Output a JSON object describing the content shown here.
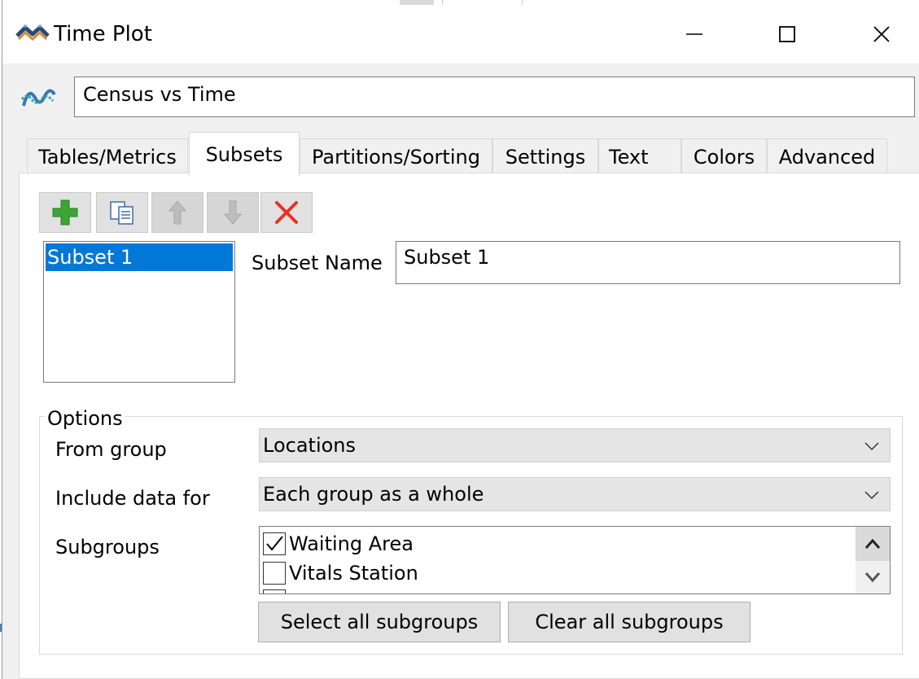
{
  "window": {
    "title": "Time Plot"
  },
  "plot_name": {
    "value": "Census vs Time"
  },
  "tabs": [
    {
      "label": "Tables/Metrics"
    },
    {
      "label": "Subsets"
    },
    {
      "label": "Partitions/Sorting"
    },
    {
      "label": "Settings"
    },
    {
      "label": "Text"
    },
    {
      "label": "Colors"
    },
    {
      "label": "Advanced"
    }
  ],
  "active_tab": "Subsets",
  "toolbar": {
    "add": "plus-icon",
    "duplicate": "copy-icon",
    "move_up": "arrow-up-icon",
    "move_down": "arrow-down-icon",
    "delete": "x-icon"
  },
  "subsets": {
    "items": [
      {
        "label": "Subset 1",
        "selected": true
      }
    ]
  },
  "subset_name": {
    "label": "Subset Name",
    "value": "Subset 1"
  },
  "options": {
    "legend": "Options",
    "from_group": {
      "label": "From group",
      "value": "Locations"
    },
    "include_data_for": {
      "label": "Include data for",
      "value": "Each group as a whole"
    },
    "subgroups": {
      "label": "Subgroups",
      "items": [
        {
          "label": "Waiting Area",
          "checked": true
        },
        {
          "label": "Vitals Station",
          "checked": false
        }
      ]
    },
    "select_all_label": "Select all subgroups",
    "clear_all_label": "Clear all subgroups"
  },
  "colors": {
    "selection": "#0078d7",
    "add_green": "#3aa635",
    "delete_red": "#e8312a"
  }
}
